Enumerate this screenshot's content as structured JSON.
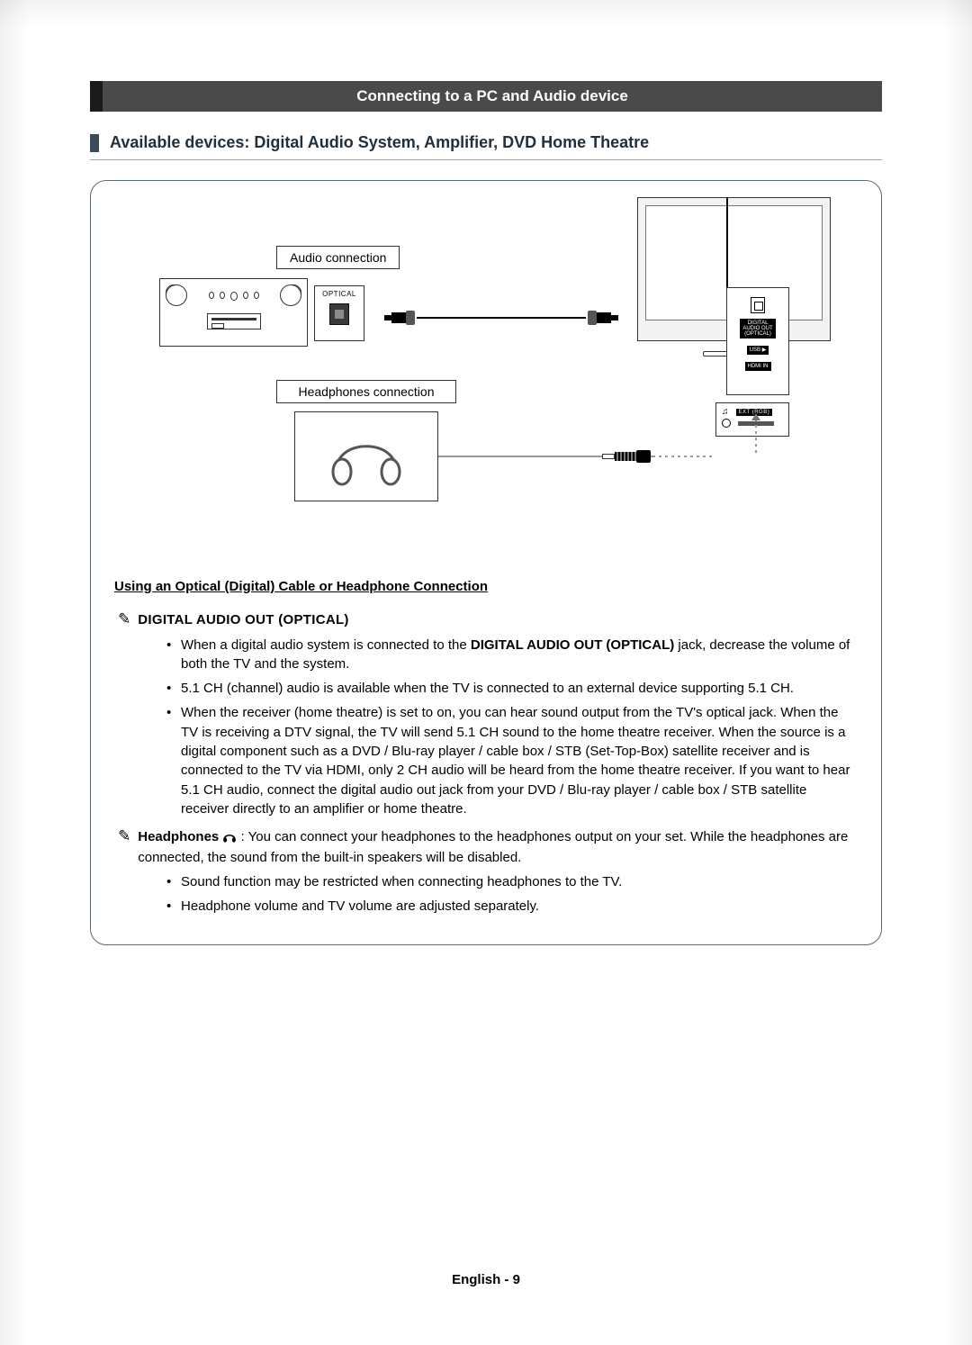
{
  "section_title": "Connecting to a PC and Audio device",
  "sub_heading": "Available devices: Digital Audio System, Amplifier, DVD Home Theatre",
  "diagram": {
    "audio_connection_label": "Audio connection",
    "headphones_connection_label": "Headphones connection",
    "optical_port_label": "OPTICAL",
    "rear_panel": {
      "digital_audio_out_label": "DIGITAL\nAUDIO OUT\n(OPTICAL)",
      "usb_label": "USB ▶",
      "hdmi_label": "HDMI IN"
    },
    "side_panel": {
      "ext_label": "EXT (RGB)"
    }
  },
  "using_heading": "Using an Optical (Digital) Cable or Headphone Connection",
  "note_icon": "✎",
  "digital_note_label": "DIGITAL AUDIO OUT (OPTICAL)",
  "digital_bullets": [
    {
      "pre": "When a digital audio system is connected to the ",
      "bold": "DIGITAL AUDIO OUT (OPTICAL)",
      "post": " jack, decrease the volume of both the TV and the system."
    },
    {
      "text": "5.1 CH (channel) audio is available when the TV is connected to an external device supporting 5.1 CH."
    },
    {
      "text": "When the receiver (home theatre) is set to on, you can hear sound output from the TV's optical jack. When the TV is receiving a DTV signal, the TV will send 5.1 CH sound to the home theatre receiver. When the source is a digital component such as a DVD / Blu-ray player / cable box / STB (Set-Top-Box) satellite receiver and is connected to the TV via HDMI, only 2 CH audio will be heard from the home theatre receiver. If you want to hear 5.1 CH audio, connect the digital audio out jack from your DVD / Blu-ray player / cable box / STB satellite receiver directly to an amplifier or home theatre."
    }
  ],
  "headphones_note": {
    "label": "Headphones",
    "icon": "♫",
    "text": ": You can connect your headphones to the headphones output on your set. While the headphones are connected, the sound from the built-in speakers will be disabled."
  },
  "headphones_bullets": [
    "Sound function may be restricted when connecting headphones to the TV.",
    "Headphone volume and TV volume are adjusted separately."
  ],
  "footer": "English - 9"
}
